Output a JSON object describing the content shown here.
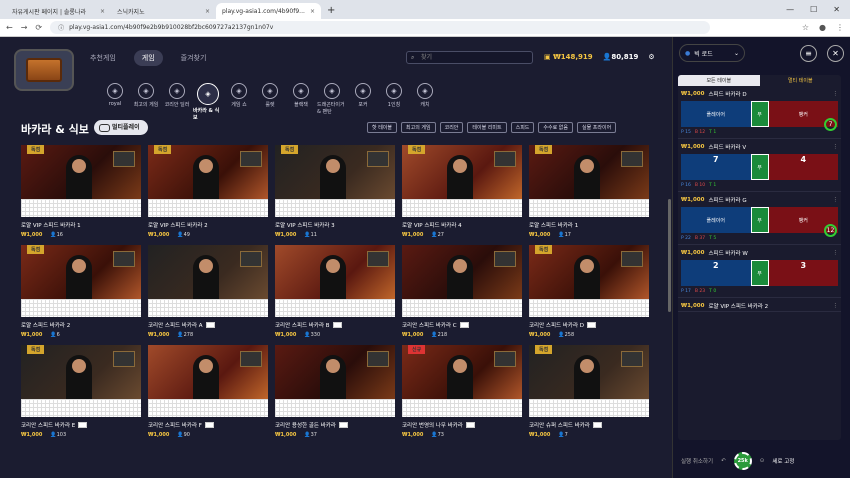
{
  "browser": {
    "tabs": [
      {
        "label": "자유게시판 페이지 | 솔롱나라",
        "active": false
      },
      {
        "label": "스닉카지노",
        "active": false
      },
      {
        "label": "play.vg-asia1.com/4b90f9...",
        "active": true
      }
    ],
    "new_tab_icon": "plus-icon",
    "url": "play.vg-asia1.com/4b90f9e2b9b910028bf2bc609727a2137gn1n07v"
  },
  "header": {
    "nav": [
      {
        "label": "추천게임",
        "active": false
      },
      {
        "label": "게임",
        "active": true
      },
      {
        "label": "즐겨찾기",
        "active": false
      }
    ],
    "search_placeholder": "찾기",
    "balance": "₩148,919",
    "users": "80,819"
  },
  "categories": [
    {
      "label": "royal",
      "icon": "crown-icon"
    },
    {
      "label": "최고의 게임",
      "icon": "trophy-icon"
    },
    {
      "label": "코리안 딜러",
      "icon": "korea-icon"
    },
    {
      "label": "바카라 & 식보",
      "icon": "cards-icon",
      "active": true
    },
    {
      "label": "게임 쇼",
      "icon": "wheel-icon"
    },
    {
      "label": "룰렛",
      "icon": "roulette-icon"
    },
    {
      "label": "블랙잭",
      "icon": "blackjack-icon"
    },
    {
      "label": "드래곤타이거 & 팬탄",
      "icon": "dragon-icon"
    },
    {
      "label": "포커",
      "icon": "poker-icon"
    },
    {
      "label": "1인칭",
      "icon": "first-person-icon"
    },
    {
      "label": "캐치",
      "icon": "catch-icon"
    }
  ],
  "section": {
    "title": "바카라 & 식보",
    "multiplay_label": "멀티플레이",
    "filters": [
      "핫 테이블",
      "최고의 게임",
      "코리안",
      "테이블 리미트",
      "스피드",
      "수수료 없음",
      "실물 프라이어"
    ]
  },
  "tables": [
    {
      "name": "로얄 VIP 스피드 바카라 1",
      "bet": "₩1,000",
      "players": "16",
      "badge": "독점",
      "flag": false
    },
    {
      "name": "로얄 VIP 스피드 바카라 2",
      "bet": "₩1,000",
      "players": "49",
      "badge": "독점",
      "flag": false
    },
    {
      "name": "로얄 VIP 스피드 바카라 3",
      "bet": "₩1,000",
      "players": "11",
      "badge": "독점",
      "flag": false
    },
    {
      "name": "로얄 VIP 스피드 바카라 4",
      "bet": "₩1,000",
      "players": "27",
      "badge": "독점",
      "flag": false
    },
    {
      "name": "로얄 스피드 바카라 1",
      "bet": "₩1,000",
      "players": "17",
      "badge": "독점",
      "flag": false
    },
    {
      "name": "로얄 스피드 바카라 2",
      "bet": "₩1,000",
      "players": "6",
      "badge": "독점",
      "flag": false
    },
    {
      "name": "코리안 스피드 바카라 A",
      "bet": "₩1,000",
      "players": "278",
      "badge": "",
      "flag": true
    },
    {
      "name": "코리안 스피드 바카라 B",
      "bet": "₩1,000",
      "players": "330",
      "badge": "",
      "flag": true
    },
    {
      "name": "코리안 스피드 바카라 C",
      "bet": "₩1,000",
      "players": "218",
      "badge": "",
      "flag": true
    },
    {
      "name": "코리안 스피드 바카라 D",
      "bet": "₩1,000",
      "players": "258",
      "badge": "독점",
      "flag": true
    },
    {
      "name": "코리안 스피드 바카라 E",
      "bet": "₩1,000",
      "players": "103",
      "badge": "독점",
      "flag": true
    },
    {
      "name": "코리안 스피드 바카라 F",
      "bet": "₩1,000",
      "players": "90",
      "badge": "",
      "flag": true
    },
    {
      "name": "코리안 용성한 골든 바카라",
      "bet": "₩1,000",
      "players": "37",
      "badge": "",
      "flag": true
    },
    {
      "name": "코리안 번영의 나무 바카라",
      "bet": "₩1,000",
      "players": "73",
      "badge": "신규",
      "flag": true
    },
    {
      "name": "코리안 슈퍼 스피드 바카라",
      "bet": "₩1,000",
      "players": "7",
      "badge": "독점",
      "flag": true
    }
  ],
  "sidebar": {
    "road_label": "빅 로드",
    "tabs": [
      {
        "label": "모든 테이블",
        "active": true
      },
      {
        "label": "멀티 테이블",
        "active": false
      }
    ],
    "rows": [
      {
        "bet": "₩1,000",
        "name": "스피드 바카라 D",
        "player_score": "",
        "banker_score": "",
        "timer": "7",
        "p": "15",
        "b": "12",
        "t": "1"
      },
      {
        "bet": "₩1,000",
        "name": "스피드 바카라 V",
        "player_score": "7",
        "banker_score": "4",
        "timer": "",
        "p": "16",
        "b": "10",
        "t": "1"
      },
      {
        "bet": "₩1,000",
        "name": "스피드 바카라 G",
        "player_score": "",
        "banker_score": "",
        "timer": "12",
        "p": "22",
        "b": "37",
        "t": "5"
      },
      {
        "bet": "₩1,000",
        "name": "스피드 바카라 W",
        "player_score": "2",
        "banker_score": "3",
        "timer": "",
        "p": "17",
        "b": "23",
        "t": "0"
      }
    ],
    "board_labels": {
      "player": "플레이어",
      "tie": "무",
      "banker": "뱅커"
    },
    "last_row": {
      "bet": "₩1,000",
      "name": "로얄 VIP 스피드 바카라 2"
    },
    "undo_label": "실행 취소하기",
    "chip_label": "25k",
    "fix_label": "세로 고정"
  }
}
